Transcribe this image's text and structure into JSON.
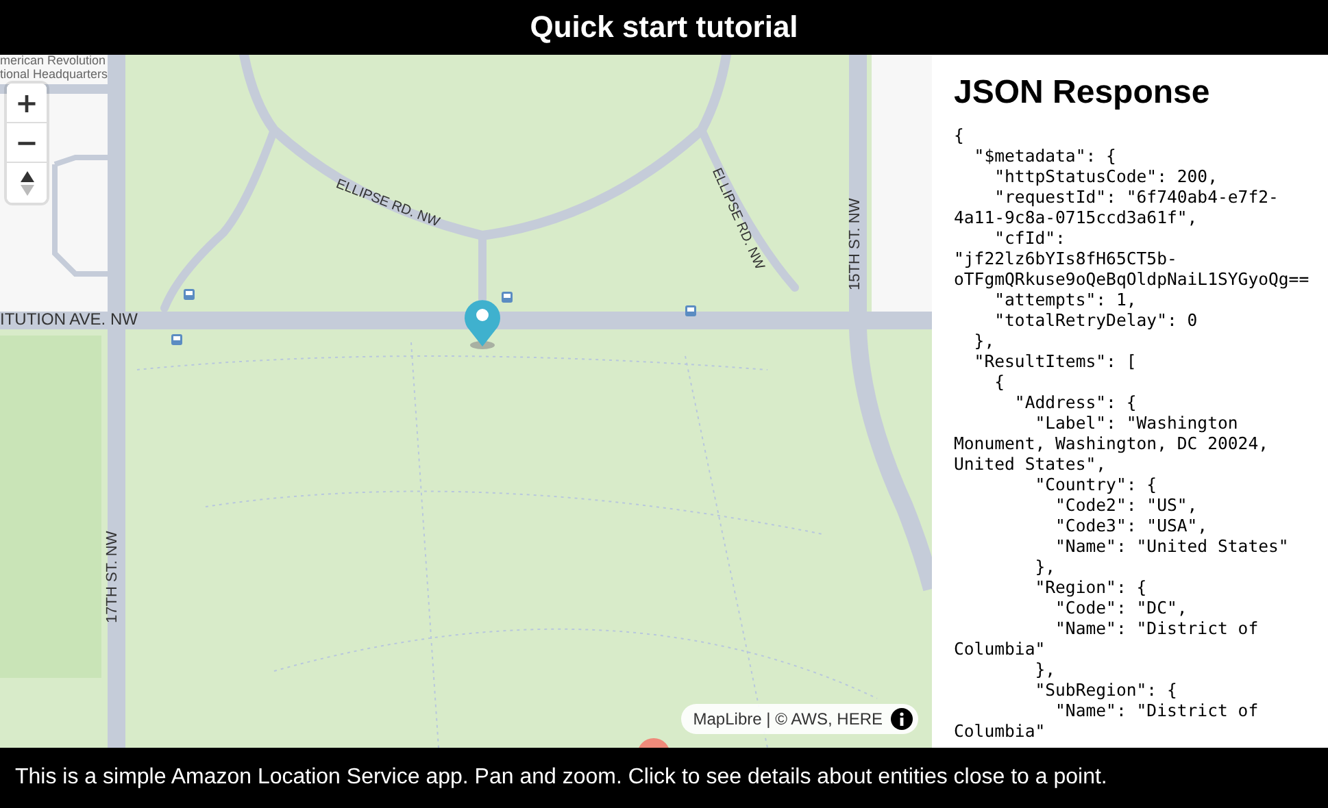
{
  "header": {
    "title": "Quick start tutorial"
  },
  "map": {
    "labels": [
      {
        "kind": "place",
        "text": "merican Revolution"
      },
      {
        "kind": "place",
        "text": "tional Headquarters"
      },
      {
        "kind": "street",
        "text": "ELLIPSE RD. NW"
      },
      {
        "kind": "street",
        "text": "ELLIPSE RD. NW"
      },
      {
        "kind": "street",
        "text": "ITUTION AVE. NW"
      },
      {
        "kind": "street",
        "text": "15TH ST. NW"
      },
      {
        "kind": "street",
        "text": "17TH ST. NW"
      }
    ],
    "zoom_in": "+",
    "zoom_out": "−",
    "attribution": "MapLibre | © AWS, HERE"
  },
  "panel": {
    "title": "JSON Response",
    "lines": [
      "{",
      "  \"$metadata\": {",
      "    \"httpStatusCode\": 200,",
      "    \"requestId\": \"6f740ab4-e7f2-",
      "4a11-9c8a-0715ccd3a61f\",",
      "    \"cfId\":",
      "\"jf22lz6bYIs8fH65CT5b-",
      "oTFgmQRkuse9oQeBqOldpNaiL1SYGyoQg==",
      "    \"attempts\": 1,",
      "    \"totalRetryDelay\": 0",
      "  },",
      "  \"ResultItems\": [",
      "    {",
      "      \"Address\": {",
      "        \"Label\": \"Washington",
      "Monument, Washington, DC 20024,",
      "United States\",",
      "        \"Country\": {",
      "          \"Code2\": \"US\",",
      "          \"Code3\": \"USA\",",
      "          \"Name\": \"United States\"",
      "        },",
      "        \"Region\": {",
      "          \"Code\": \"DC\",",
      "          \"Name\": \"District of",
      "Columbia\"",
      "        },",
      "        \"SubRegion\": {",
      "          \"Name\": \"District of",
      "Columbia\""
    ]
  },
  "footer": {
    "text": "This is a simple Amazon Location Service app. Pan and zoom. Click to see details about entities close to a point."
  }
}
